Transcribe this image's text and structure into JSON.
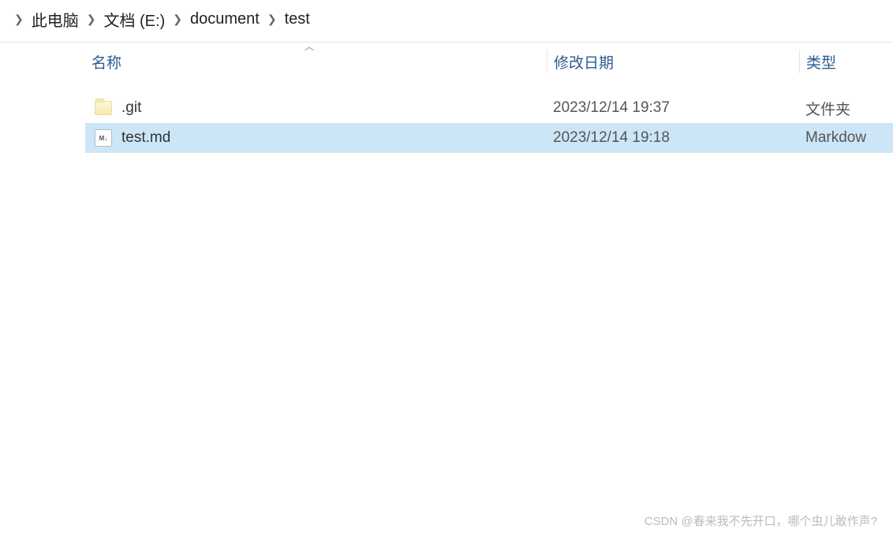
{
  "breadcrumb": {
    "items": [
      {
        "label": "此电脑"
      },
      {
        "label": "文档 (E:)"
      },
      {
        "label": "document"
      },
      {
        "label": "test"
      }
    ]
  },
  "columns": {
    "name": "名称",
    "date": "修改日期",
    "type": "类型"
  },
  "files": [
    {
      "icon": "folder",
      "name": ".git",
      "date": "2023/12/14 19:37",
      "type": "文件夹",
      "selected": false
    },
    {
      "icon": "markdown",
      "name": "test.md",
      "date": "2023/12/14 19:18",
      "type": "Markdow",
      "selected": true
    }
  ],
  "watermark": "CSDN @春来我不先开口，哪个虫儿敢作声?"
}
